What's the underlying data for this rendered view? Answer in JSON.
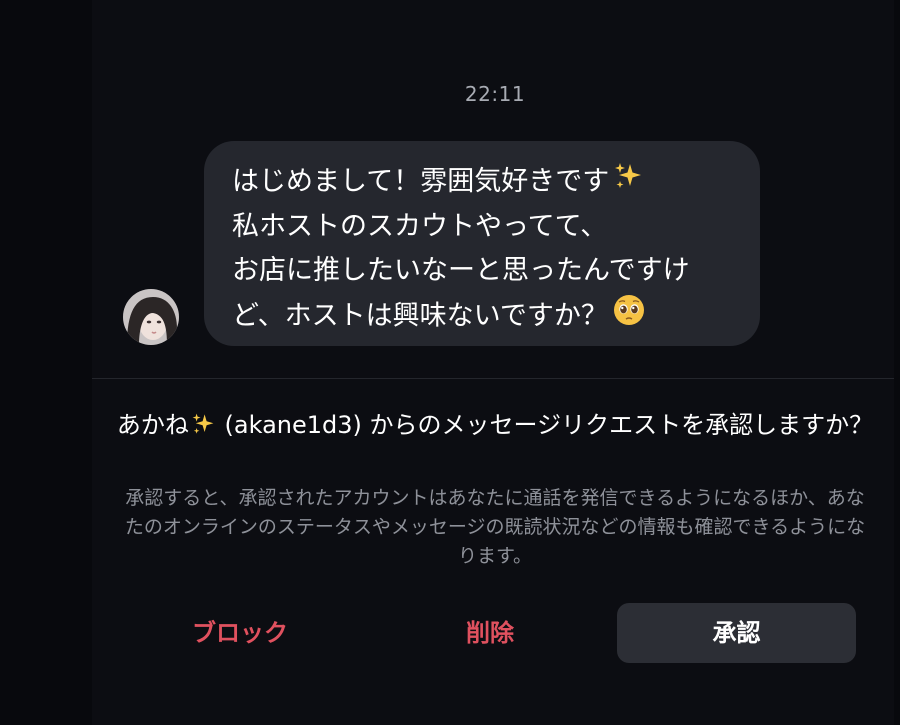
{
  "chat": {
    "timestamp": "22:11",
    "message": {
      "line1": "はじめまして！雰囲気好きです",
      "line1_emoji": "sparkles-emoji",
      "line2": "私ホストのスカウトやってて、",
      "line3": "お店に推したいなーと思ったんですけ",
      "line4": "ど、ホストは興味ないですか？",
      "line4_emoji": "pleading-face-emoji"
    },
    "sender_avatar": "profile-avatar"
  },
  "request": {
    "title_prefix": "あかね",
    "title_emoji": "sparkles-emoji",
    "title_rest": " (akane1d3) からのメッセージリクエストを承認しますか？",
    "description": "承認すると、承認されたアカウントはあなたに通話を発信できるようになるほか、あなたのオンラインのステータスやメッセージの既読状況などの情報も確認できるようになります。"
  },
  "actions": {
    "block_label": "ブロック",
    "delete_label": "削除",
    "accept_label": "承認"
  },
  "colors": {
    "background": "#0c0d12",
    "bubble": "#25272e",
    "danger": "#e0515f",
    "accept_bg": "#2c2e35",
    "secondary_text": "#8e9199"
  }
}
